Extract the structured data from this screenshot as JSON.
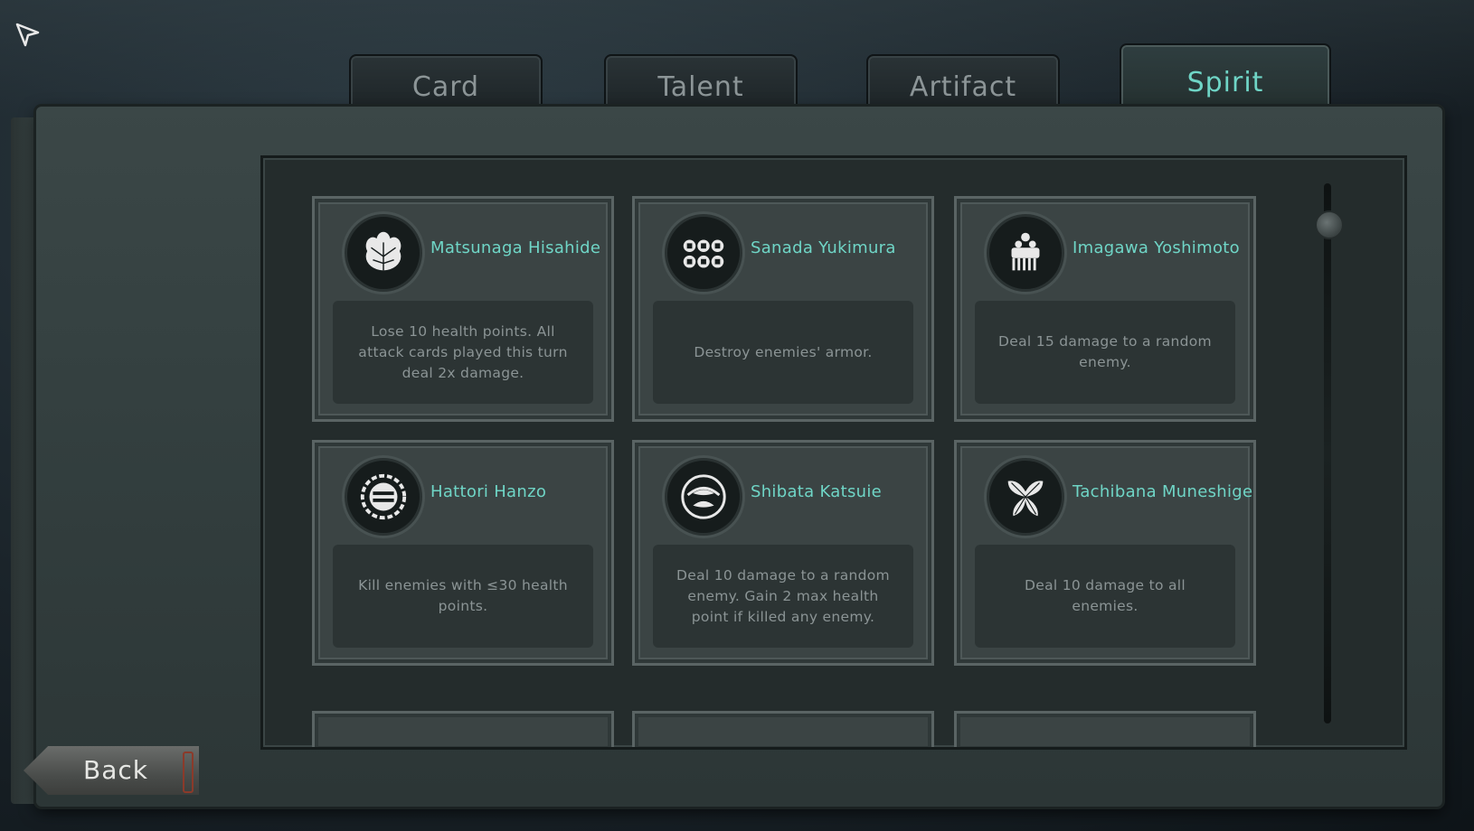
{
  "tabs": [
    {
      "label": "Card"
    },
    {
      "label": "Talent"
    },
    {
      "label": "Artifact"
    },
    {
      "label": "Spirit",
      "active": true
    }
  ],
  "spirits": [
    {
      "name": "Matsunaga Hisahide",
      "description": "Lose 10 health points. All attack cards played this turn deal 2x damage.",
      "emblem": "paulownia-crest-icon"
    },
    {
      "name": "Sanada Yukimura",
      "description": "Destroy enemies' armor.",
      "emblem": "six-coins-crest-icon"
    },
    {
      "name": "Imagawa Yoshimoto",
      "description": "Deal 15 damage to a random enemy.",
      "emblem": "comb-crest-icon"
    },
    {
      "name": "Hattori Hanzo",
      "description": "Kill enemies with ≤30 health points.",
      "emblem": "wheel-crest-icon"
    },
    {
      "name": "Shibata Katsuie",
      "description": "Deal 10 damage to a random enemy. Gain 2 max health point if killed any enemy.",
      "emblem": "wild-goose-crest-icon"
    },
    {
      "name": "Tachibana Muneshige",
      "description": "Deal 10 damage to all enemies.",
      "emblem": "gingko-crest-icon"
    }
  ],
  "back_button": {
    "label": "Back"
  },
  "colors": {
    "accent": "#6fd5c6",
    "text_muted": "#8b9495"
  }
}
